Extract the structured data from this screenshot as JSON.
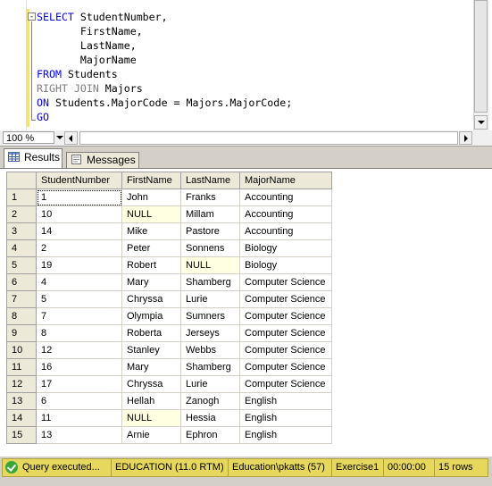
{
  "editor": {
    "outline_toggle": "-",
    "lines": [
      {
        "kw": "SELECT",
        "rest": " StudentNumber,"
      },
      {
        "kw": "",
        "rest": "       FirstName,"
      },
      {
        "kw": "",
        "rest": "       LastName,"
      },
      {
        "kw": "",
        "rest": "       MajorName"
      },
      {
        "kw": "FROM",
        "rest": " Students"
      },
      {
        "kw": "RIGHT JOIN",
        "rest": " Majors"
      },
      {
        "kw": "ON",
        "rest": " Students.MajorCode = Majors.MajorCode;"
      },
      {
        "kw": "GO",
        "rest": ""
      }
    ]
  },
  "zoom": "100 %",
  "tabs": {
    "results": "Results",
    "messages": "Messages"
  },
  "grid": {
    "headers": [
      "",
      "StudentNumber",
      "FirstName",
      "LastName",
      "MajorName"
    ],
    "rows": [
      [
        "1",
        "1",
        "John",
        "Franks",
        "Accounting"
      ],
      [
        "2",
        "10",
        "NULL",
        "Millam",
        "Accounting"
      ],
      [
        "3",
        "14",
        "Mike",
        "Pastore",
        "Accounting"
      ],
      [
        "4",
        "2",
        "Peter",
        "Sonnens",
        "Biology"
      ],
      [
        "5",
        "19",
        "Robert",
        "NULL",
        "Biology"
      ],
      [
        "6",
        "4",
        "Mary",
        "Shamberg",
        "Computer Science"
      ],
      [
        "7",
        "5",
        "Chryssa",
        "Lurie",
        "Computer Science"
      ],
      [
        "8",
        "7",
        "Olympia",
        "Sumners",
        "Computer Science"
      ],
      [
        "9",
        "8",
        "Roberta",
        "Jerseys",
        "Computer Science"
      ],
      [
        "10",
        "12",
        "Stanley",
        "Webbs",
        "Computer Science"
      ],
      [
        "11",
        "16",
        "Mary",
        "Shamberg",
        "Computer Science"
      ],
      [
        "12",
        "17",
        "Chryssa",
        "Lurie",
        "Computer Science"
      ],
      [
        "13",
        "6",
        "Hellah",
        "Zanogh",
        "English"
      ],
      [
        "14",
        "11",
        "NULL",
        "Hessia",
        "English"
      ],
      [
        "15",
        "13",
        "Arnie",
        "Ephron",
        "English"
      ]
    ]
  },
  "status": {
    "message": "Query executed...",
    "server": "EDUCATION (11.0 RTM)",
    "login": "Education\\pkatts (57)",
    "database": "Exercise1",
    "elapsed": "00:00:00",
    "rows": "15 rows"
  },
  "colors": {
    "keyword": "#0000ff",
    "null_cell": "#ffffe1",
    "status_bar": "#e6d85c"
  }
}
